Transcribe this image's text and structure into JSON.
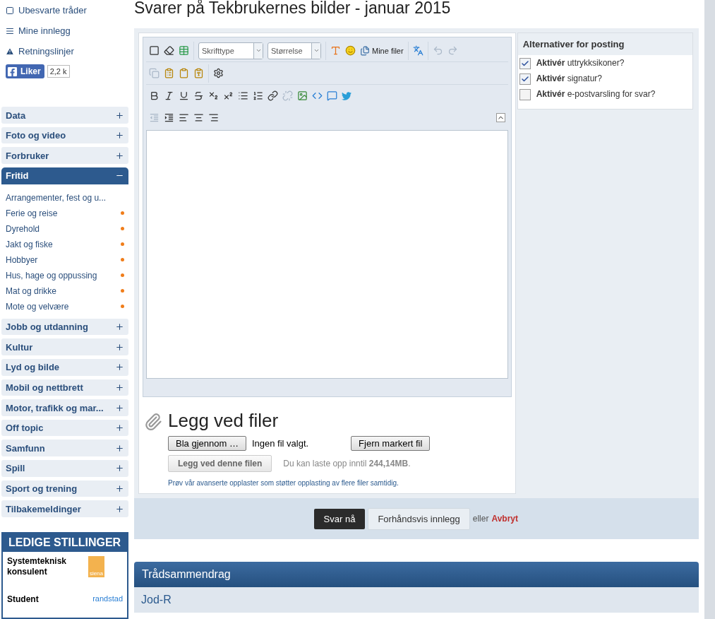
{
  "sidebar": {
    "links": [
      {
        "kind": "unanswered",
        "label": "Ubesvarte tråder"
      },
      {
        "kind": "posts",
        "label": "Mine innlegg"
      },
      {
        "kind": "guidelines",
        "label": "Retningslinjer"
      }
    ],
    "like": {
      "label": "Liker",
      "count": "2,2 k"
    },
    "categories": [
      {
        "label": "Data",
        "expanded": false
      },
      {
        "label": "Foto og video",
        "expanded": false
      },
      {
        "label": "Forbruker",
        "expanded": false
      },
      {
        "label": "Fritid",
        "expanded": true,
        "children": [
          {
            "label": "Arrangementer, fest og u...",
            "unread": false
          },
          {
            "label": "Ferie og reise",
            "unread": true
          },
          {
            "label": "Dyrehold",
            "unread": true
          },
          {
            "label": "Jakt og fiske",
            "unread": true
          },
          {
            "label": "Hobbyer",
            "unread": true
          },
          {
            "label": "Hus, hage og oppussing",
            "unread": true
          },
          {
            "label": "Mat og drikke",
            "unread": true
          },
          {
            "label": "Mote og velvære",
            "unread": true
          }
        ]
      },
      {
        "label": "Jobb og utdanning",
        "expanded": false
      },
      {
        "label": "Kultur",
        "expanded": false
      },
      {
        "label": "Lyd og bilde",
        "expanded": false
      },
      {
        "label": "Mobil og nettbrett",
        "expanded": false
      },
      {
        "label": "Motor, trafikk og mar...",
        "expanded": false
      },
      {
        "label": "Off topic",
        "expanded": false
      },
      {
        "label": "Samfunn",
        "expanded": false
      },
      {
        "label": "Spill",
        "expanded": false
      },
      {
        "label": "Sport og trening",
        "expanded": false
      },
      {
        "label": "Tilbakemeldinger",
        "expanded": false
      }
    ],
    "jobs": {
      "title": "LEDIGE STILLINGER",
      "items": [
        {
          "title": "Systemteknisk konsulent",
          "logo": "siena"
        },
        {
          "title": "Student",
          "logo": "randstad"
        }
      ]
    }
  },
  "page": {
    "title": "Svarer på Tekbrukernes bilder - januar 2015"
  },
  "editor": {
    "font_placeholder": "Skrifttype",
    "size_placeholder": "Størrelse",
    "my_files": "Mine filer"
  },
  "options": {
    "title": "Alternativer for posting",
    "items": [
      {
        "text": "**Aktivér** uttrykksikoner?",
        "checked": true
      },
      {
        "text": "**Aktivér** signatur?",
        "checked": true
      },
      {
        "text": "**Aktivér** e-postvarsling for svar?",
        "checked": false
      }
    ]
  },
  "attachments": {
    "title": "Legg ved filer",
    "browse": "Bla gjennom …",
    "no_file": "Ingen fil valgt.",
    "remove": "Fjern markert fil",
    "attach": "Legg ved denne filen",
    "limit": "Du kan laste opp inntil **244,14MB**.",
    "advanced": "Prøv vår avanserte opplaster som støtter opplasting av flere filer samtidig."
  },
  "actions": {
    "submit": "Svar nå",
    "preview": "Forhåndsvis innlegg",
    "or": "eller",
    "cancel": "Avbryt"
  },
  "summary": {
    "title": "Trådsammendrag",
    "author": "Jod-R"
  }
}
